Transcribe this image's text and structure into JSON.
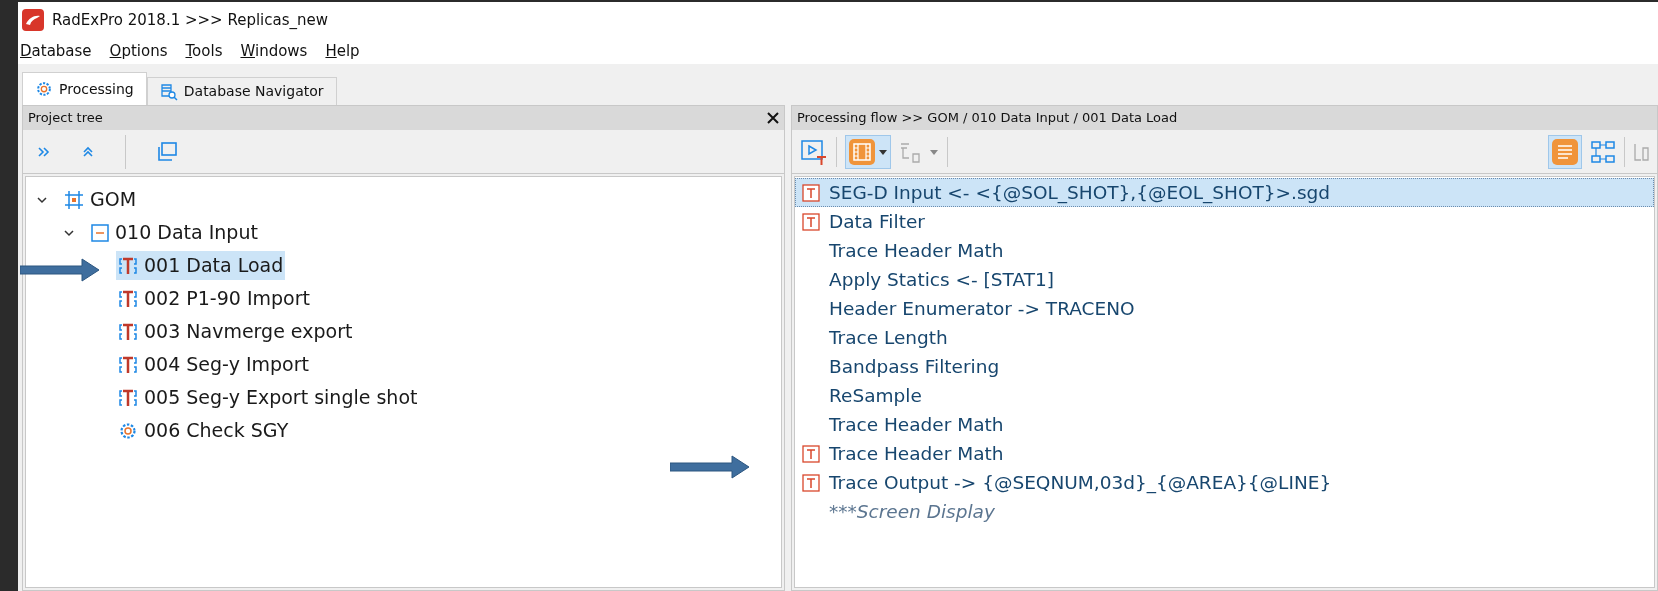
{
  "window": {
    "title": "RadExPro 2018.1 >>> Replicas_new"
  },
  "menu": [
    {
      "label": "Database"
    },
    {
      "label": "Options"
    },
    {
      "label": "Tools"
    },
    {
      "label": "Windows"
    },
    {
      "label": "Help"
    }
  ],
  "tabs": [
    {
      "label": "Processing",
      "kind": "processing",
      "selected": true
    },
    {
      "label": "Database Navigator",
      "kind": "navigator",
      "selected": false
    }
  ],
  "project_tree": {
    "title": "Project tree",
    "items": [
      {
        "label": "GOM",
        "kind": "project",
        "expanded": true,
        "selected": false,
        "children": [
          {
            "label": "010 Data Input",
            "kind": "line",
            "expanded": true,
            "selected": false,
            "children": [
              {
                "label": "001 Data Load",
                "kind": "flow-t",
                "selected": true
              },
              {
                "label": "002 P1-90 Import",
                "kind": "flow-t",
                "selected": false
              },
              {
                "label": "003 Navmerge export",
                "kind": "flow-t",
                "selected": false
              },
              {
                "label": "004 Seg-y Import",
                "kind": "flow-t",
                "selected": false
              },
              {
                "label": "005 Seg-y Export single shot",
                "kind": "flow-t",
                "selected": false
              },
              {
                "label": "006 Check SGY",
                "kind": "flow",
                "selected": false
              }
            ]
          }
        ]
      }
    ]
  },
  "processing_flow": {
    "title": "Processing flow >> GOM / 010 Data Input / 001 Data Load",
    "items": [
      {
        "label": "SEG-D Input <- <{@SOL_SHOT},{@EOL_SHOT}>.sgd",
        "kind": "flagged",
        "selected": true
      },
      {
        "label": "Data Filter",
        "kind": "flagged",
        "selected": false
      },
      {
        "label": "Trace Header Math",
        "kind": "plain",
        "selected": false
      },
      {
        "label": "Apply Statics <- [STAT1]",
        "kind": "plain",
        "selected": false
      },
      {
        "label": "Header Enumerator -> TRACENO",
        "kind": "plain",
        "selected": false
      },
      {
        "label": "Trace Length",
        "kind": "plain",
        "selected": false
      },
      {
        "label": "Bandpass Filtering",
        "kind": "plain",
        "selected": false
      },
      {
        "label": "ReSample",
        "kind": "plain",
        "selected": false
      },
      {
        "label": "Trace Header Math",
        "kind": "plain",
        "selected": false
      },
      {
        "label": "Trace Header Math",
        "kind": "flagged",
        "selected": false
      },
      {
        "label": "Trace Output -> {@SEQNUM,03d}_{@AREA}{@LINE}",
        "kind": "flagged",
        "selected": false
      },
      {
        "label": "***Screen Display",
        "kind": "commented",
        "selected": false
      }
    ]
  }
}
